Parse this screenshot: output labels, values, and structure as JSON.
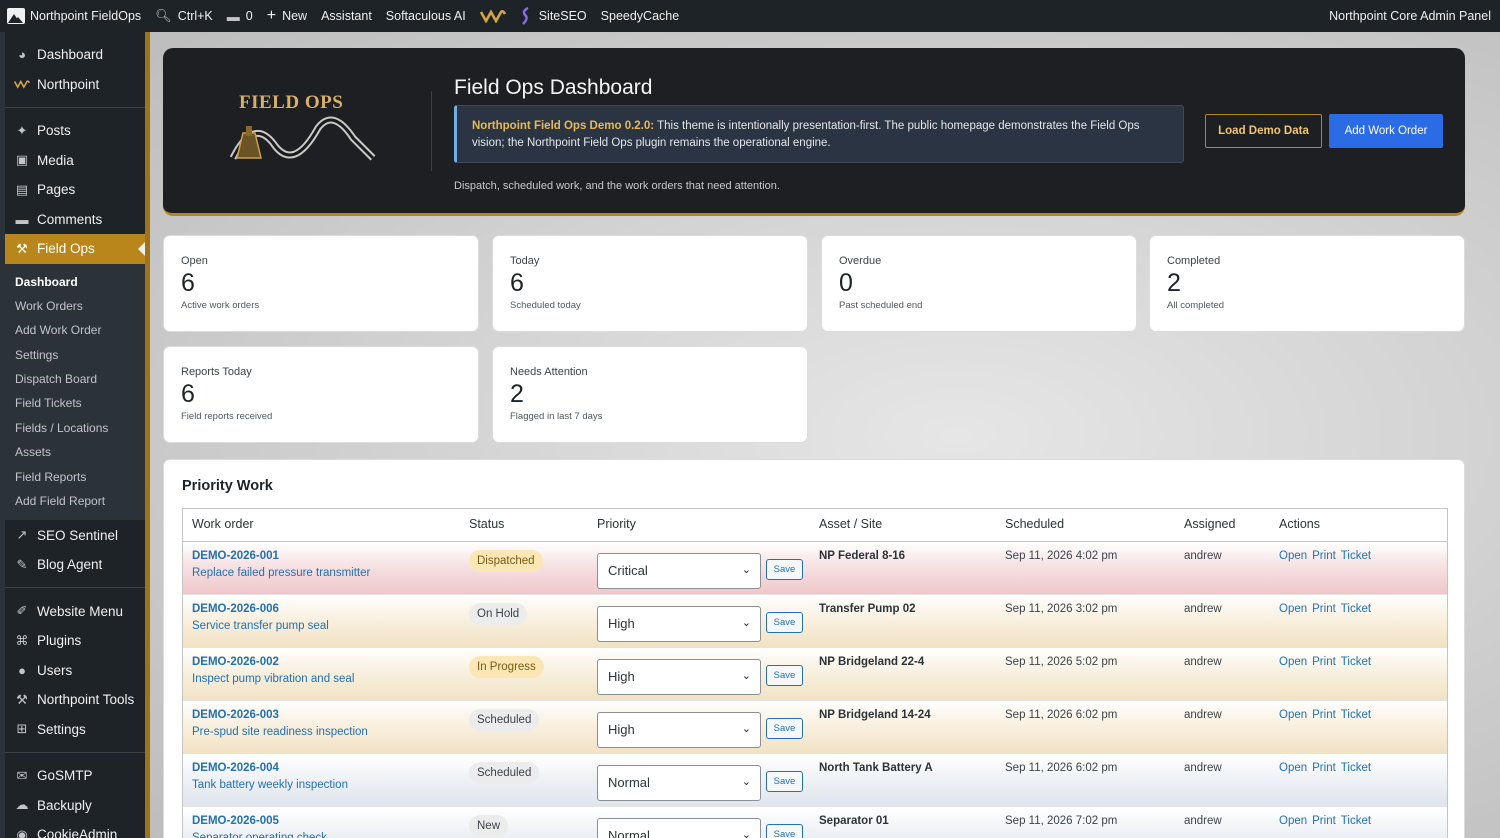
{
  "colors": {
    "accent": "#b8861a",
    "link": "#2271b1",
    "primary_button": "#2c6be6",
    "admin_dark": "#1d2327"
  },
  "adminbar": {
    "site_name": "Northpoint FieldOps",
    "search_shortcut": "Ctrl+K",
    "comment_count": "0",
    "new_label": "New",
    "assistant_label": "Assistant",
    "softaculous_label": "Softaculous AI",
    "siteseo_label": "SiteSEO",
    "speedycache_label": "SpeedyCache",
    "right_label": "Northpoint Core Admin Panel"
  },
  "sidebar": {
    "items_top": [
      {
        "label": "Dashboard",
        "icon": "dashboard-icon"
      },
      {
        "label": "Northpoint",
        "icon": "northpoint-logo-icon"
      }
    ],
    "items_content": [
      {
        "label": "Posts",
        "icon": "pin-icon"
      },
      {
        "label": "Media",
        "icon": "media-icon"
      },
      {
        "label": "Pages",
        "icon": "pages-icon"
      },
      {
        "label": "Comments",
        "icon": "comment-icon"
      },
      {
        "label": "Field Ops",
        "icon": "fieldops-icon"
      }
    ],
    "submenu": [
      "Dashboard",
      "Work Orders",
      "Add Work Order",
      "Settings",
      "Dispatch Board",
      "Field Tickets",
      "Fields / Locations",
      "Assets",
      "Field Reports",
      "Add Field Report"
    ],
    "items_after": [
      {
        "label": "SEO Sentinel",
        "icon": "chart-icon"
      },
      {
        "label": "Blog Agent",
        "icon": "edit-icon"
      }
    ],
    "items_admin": [
      {
        "label": "Website Menu",
        "icon": "brush-icon"
      },
      {
        "label": "Plugins",
        "icon": "plugin-icon"
      },
      {
        "label": "Users",
        "icon": "user-icon"
      },
      {
        "label": "Northpoint Tools",
        "icon": "wrench-icon"
      },
      {
        "label": "Settings",
        "icon": "settings-icon"
      }
    ],
    "items_bottom": [
      {
        "label": "GoSMTP",
        "icon": "mail-icon"
      },
      {
        "label": "Backuply",
        "icon": "cloud-upload-icon"
      },
      {
        "label": "CookieAdmin",
        "icon": "cookie-icon"
      }
    ]
  },
  "hero": {
    "logo_text": "FIELD OPS",
    "title": "Field Ops Dashboard",
    "notice_strong": "Northpoint Field Ops Demo 0.2.0:",
    "notice_text": " This theme is intentionally presentation-first. The public homepage demonstrates the Field Ops vision; the Northpoint Field Ops plugin remains the operational engine.",
    "load_demo_label": "Load Demo Data",
    "add_work_order_label": "Add Work Order",
    "subtitle": "Dispatch, scheduled work, and the work orders that need attention."
  },
  "stats": [
    {
      "label": "Open",
      "value": "6",
      "sub": "Active work orders"
    },
    {
      "label": "Today",
      "value": "6",
      "sub": "Scheduled today"
    },
    {
      "label": "Overdue",
      "value": "0",
      "sub": "Past scheduled end"
    },
    {
      "label": "Completed",
      "value": "2",
      "sub": "All completed"
    },
    {
      "label": "Reports Today",
      "value": "6",
      "sub": "Field reports received"
    },
    {
      "label": "Needs Attention",
      "value": "2",
      "sub": "Flagged in last 7 days"
    }
  ],
  "priority": {
    "title": "Priority Work",
    "headers": [
      "Work order",
      "Status",
      "Priority",
      "Asset / Site",
      "Scheduled",
      "Assigned",
      "Actions"
    ],
    "save_label": "Save",
    "actions": [
      "Open",
      "Print",
      "Ticket"
    ],
    "rows": [
      {
        "id": "DEMO-2026-001",
        "title": "Replace failed pressure transmitter",
        "status": "Dispatched",
        "status_bg": "#fbe7b5",
        "status_fg": "#7a5a10",
        "priority": "Critical",
        "asset": "NP Federal 8-16",
        "scheduled": "Sep 11, 2026 4:02 pm",
        "assigned": "andrew",
        "row_bg": "linear-gradient(180deg,#ffffff 0%,#f7e2e3 45%,#efc7ca 100%)"
      },
      {
        "id": "DEMO-2026-006",
        "title": "Service transfer pump seal",
        "status": "On Hold",
        "status_bg": "#ececec",
        "status_fg": "#3c434a",
        "priority": "High",
        "asset": "Transfer Pump 02",
        "scheduled": "Sep 11, 2026 3:02 pm",
        "assigned": "andrew",
        "row_bg": "linear-gradient(180deg,#ffffff 0%,#f8efdd 50%,#f1e2c4 100%)"
      },
      {
        "id": "DEMO-2026-002",
        "title": "Inspect pump vibration and seal",
        "status": "In Progress",
        "status_bg": "#fbe7b5",
        "status_fg": "#7a5a10",
        "priority": "High",
        "asset": "NP Bridgeland 22-4",
        "scheduled": "Sep 11, 2026 5:02 pm",
        "assigned": "andrew",
        "row_bg": "linear-gradient(180deg,#ffffff 0%,#f8efdd 50%,#f1e2c4 100%)"
      },
      {
        "id": "DEMO-2026-003",
        "title": "Pre-spud site readiness inspection",
        "status": "Scheduled",
        "status_bg": "#ececec",
        "status_fg": "#3c434a",
        "priority": "High",
        "asset": "NP Bridgeland 14-24",
        "scheduled": "Sep 11, 2026 6:02 pm",
        "assigned": "andrew",
        "row_bg": "linear-gradient(180deg,#ffffff 0%,#f8efdd 50%,#f1e2c4 100%)"
      },
      {
        "id": "DEMO-2026-004",
        "title": "Tank battery weekly inspection",
        "status": "Scheduled",
        "status_bg": "#ececec",
        "status_fg": "#3c434a",
        "priority": "Normal",
        "asset": "North Tank Battery A",
        "scheduled": "Sep 11, 2026 6:02 pm",
        "assigned": "andrew",
        "row_bg": "linear-gradient(180deg,#ffffff 0%,#eef1f5 50%,#dfe5ee 100%)"
      },
      {
        "id": "DEMO-2026-005",
        "title": "Separator operating check",
        "status": "New",
        "status_bg": "#ececec",
        "status_fg": "#3c434a",
        "priority": "Normal",
        "asset": "Separator 01",
        "scheduled": "Sep 11, 2026 7:02 pm",
        "assigned": "andrew",
        "row_bg": "linear-gradient(180deg,#ffffff 0%,#eef1f5 50%,#dfe5ee 100%)"
      }
    ]
  }
}
